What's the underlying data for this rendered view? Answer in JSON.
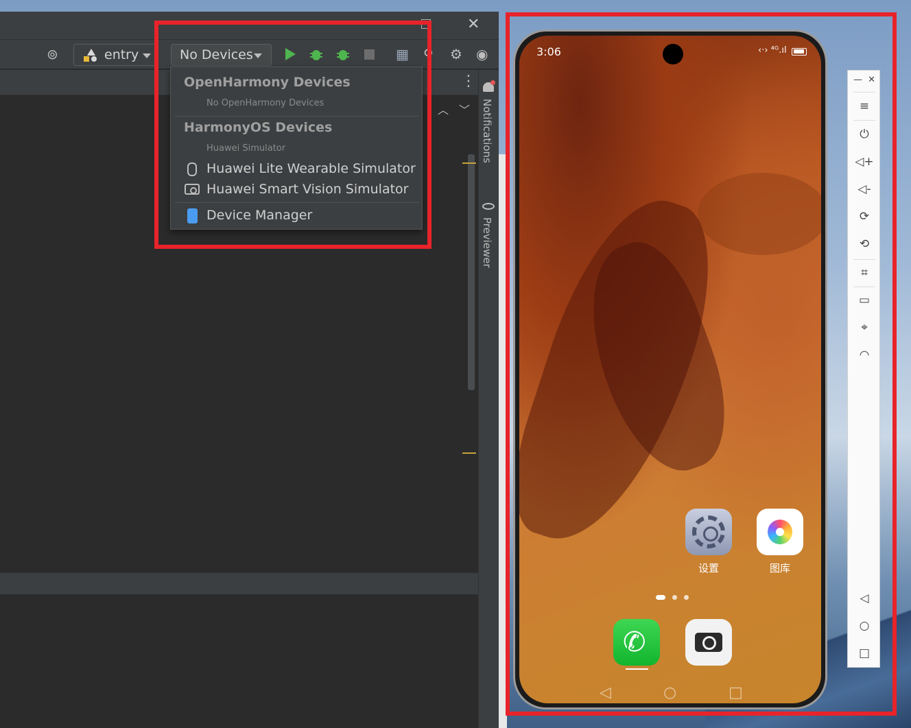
{
  "ide": {
    "toolbar": {
      "module_selector": "entry",
      "device_selector": "No Devices"
    },
    "right_strip": {
      "notifications_label": "Notifications",
      "previewer_label": "Previewer"
    }
  },
  "dropdown": {
    "openharmony": {
      "header": "OpenHarmony Devices",
      "empty_text": "No OpenHarmony Devices"
    },
    "harmonyos": {
      "header": "HarmonyOS Devices",
      "subheader": "Huawei Simulator",
      "items": [
        {
          "label": "Huawei Lite Wearable Simulator",
          "icon": "watch-icon"
        },
        {
          "label": "Huawei Smart Vision Simulator",
          "icon": "camera-icon"
        }
      ]
    },
    "device_manager": {
      "label": "Device Manager",
      "icon": "phone-icon"
    }
  },
  "phone": {
    "status_bar": {
      "time": "3:06",
      "icons_text": "‹·› ⁴ᴳ.ıl"
    },
    "home_apps": [
      {
        "label": "设置",
        "icon": "settings-icon"
      },
      {
        "label": "图库",
        "icon": "gallery-icon"
      }
    ],
    "dock_apps": [
      {
        "label": "",
        "icon": "phone-call-icon"
      },
      {
        "label": "",
        "icon": "camera-icon"
      }
    ],
    "page_indicator": {
      "pages": 3,
      "current": 1
    },
    "nav": {
      "back": "◁",
      "home": "○",
      "recents": "□"
    }
  },
  "colors": {
    "highlight": "#e8232a",
    "ide_bg": "#2b2b2b",
    "run_green": "#4fb54f"
  }
}
